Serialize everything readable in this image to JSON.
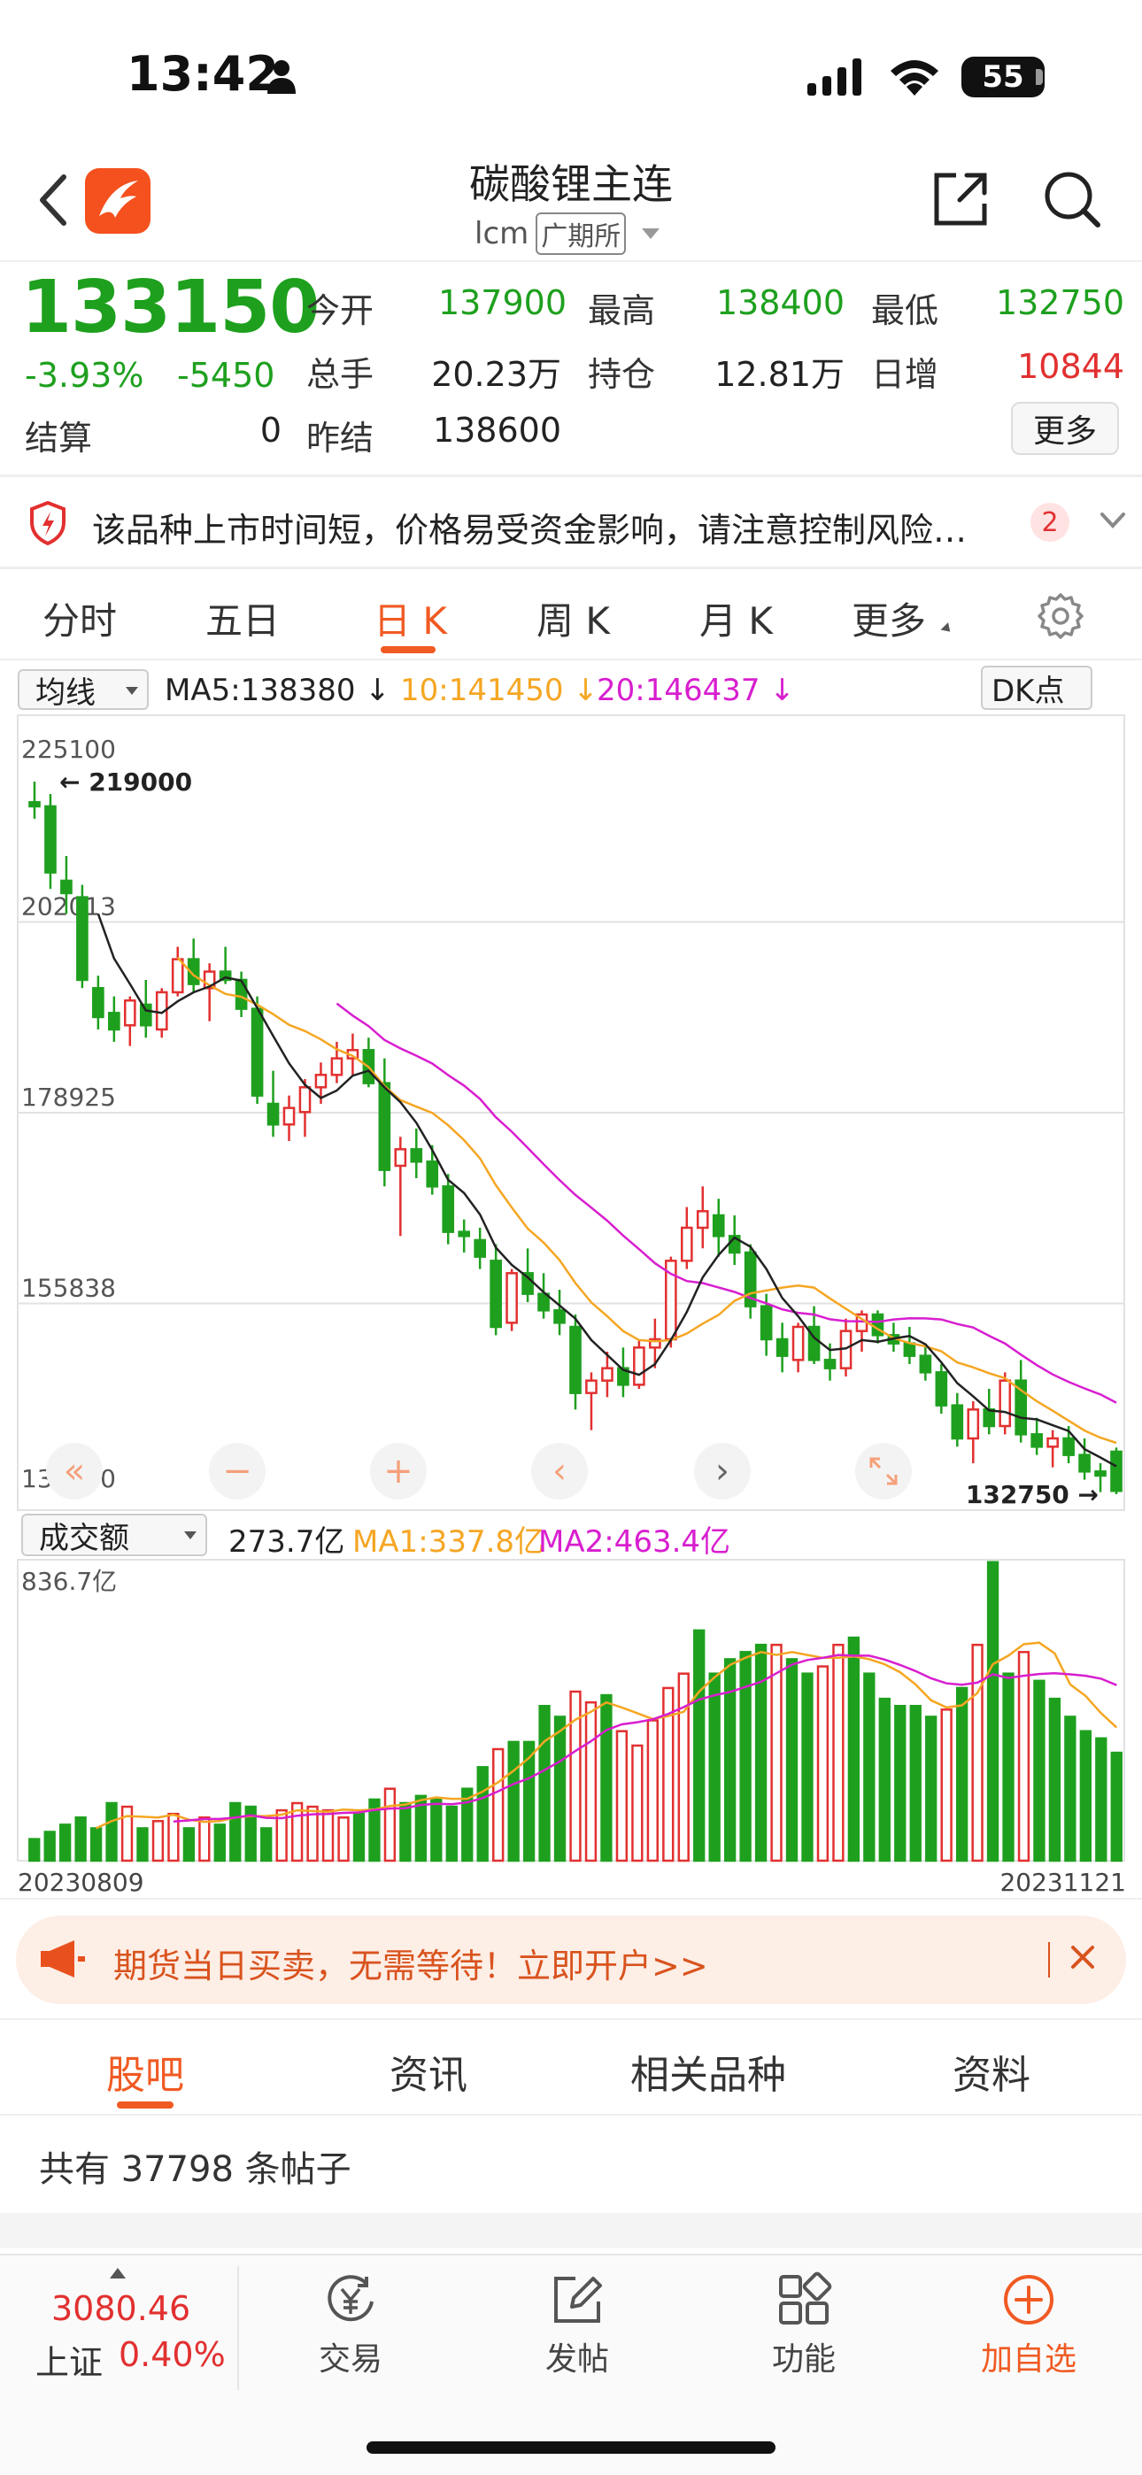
{
  "status_bar": {
    "time": "13:42",
    "battery": "55"
  },
  "header": {
    "title": "碳酸锂主连",
    "code": "lcm",
    "exchange": "广期所"
  },
  "quote": {
    "price": "133150",
    "change_pct": "-3.93%",
    "change": "-5450",
    "fields": [
      {
        "label": "今开",
        "value": "137900",
        "color": "green"
      },
      {
        "label": "最高",
        "value": "138400",
        "color": "green"
      },
      {
        "label": "最低",
        "value": "132750",
        "color": "green"
      },
      {
        "label": "总手",
        "value": "20.23万",
        "color": "black"
      },
      {
        "label": "持仓",
        "value": "12.81万",
        "color": "black"
      },
      {
        "label": "日增",
        "value": "10844",
        "color": "red"
      },
      {
        "label": "结算",
        "value": "0",
        "color": "black"
      },
      {
        "label": "昨结",
        "value": "138600",
        "color": "black"
      }
    ],
    "more_label": "更多"
  },
  "notice": {
    "text": "该品种上市时间短，价格易受资金影响，请注意控制风险…",
    "badge": "2"
  },
  "tabs": {
    "items": [
      "分时",
      "五日",
      "日 K",
      "周 K",
      "月 K",
      "更多"
    ],
    "active": 2
  },
  "indicators": {
    "ma_select": "均线",
    "ma5": "MA5:138380",
    "ma10": "10:141450",
    "ma20": "20:146437",
    "dk_label": "DK点",
    "vol_select": "成交额",
    "vol_value": "273.7亿",
    "vma1": "MA1:337.8亿",
    "vma2": "MA2:463.4亿"
  },
  "colors": {
    "up": "#e23030",
    "down": "#1ea01e",
    "ma5": "#222222",
    "ma10": "#f5a623",
    "ma20": "#d81ecf",
    "accent": "#f05a23"
  },
  "chart_data": [
    {
      "type": "candlestick",
      "y_ticks": [
        "225100",
        "202013",
        "178925",
        "155838",
        "132750"
      ],
      "ylim": [
        132750,
        225100
      ],
      "annotations": [
        "219000",
        "132750"
      ],
      "ohlc": [
        [
          216500,
          219000,
          214500,
          216000
        ],
        [
          216000,
          217500,
          206000,
          208000
        ],
        [
          207000,
          210000,
          203000,
          205500
        ],
        [
          205000,
          206500,
          194000,
          195000
        ],
        [
          194000,
          195500,
          189000,
          190500
        ],
        [
          191000,
          193000,
          187500,
          189000
        ],
        [
          189500,
          193000,
          187000,
          192500
        ],
        [
          192000,
          195000,
          188000,
          189500
        ],
        [
          189000,
          194000,
          188000,
          193500
        ],
        [
          193500,
          199000,
          193000,
          197500
        ],
        [
          197500,
          200000,
          193500,
          194500
        ],
        [
          194000,
          197000,
          190000,
          196000
        ],
        [
          196000,
          199000,
          194500,
          195000
        ],
        [
          195000,
          196000,
          190500,
          191500
        ],
        [
          191500,
          193000,
          180000,
          181000
        ],
        [
          180000,
          184000,
          176000,
          177500
        ],
        [
          177500,
          181000,
          175500,
          179500
        ],
        [
          179000,
          183000,
          176000,
          182000
        ],
        [
          182000,
          185000,
          180000,
          183500
        ],
        [
          183500,
          187500,
          182500,
          185500
        ],
        [
          185500,
          188500,
          183500,
          186500
        ],
        [
          186500,
          188000,
          182000,
          182500
        ],
        [
          182500,
          185500,
          170000,
          172000
        ],
        [
          172500,
          176000,
          164000,
          174500
        ],
        [
          174500,
          177000,
          171000,
          173000
        ],
        [
          173000,
          175000,
          169000,
          170000
        ],
        [
          170000,
          171500,
          163000,
          164500
        ],
        [
          164500,
          166000,
          162000,
          164000
        ],
        [
          163500,
          165000,
          160000,
          161500
        ],
        [
          161000,
          163000,
          152000,
          153000
        ],
        [
          153500,
          160000,
          152500,
          159500
        ],
        [
          159500,
          162500,
          156000,
          157000
        ],
        [
          157000,
          159500,
          154000,
          155000
        ],
        [
          155000,
          157500,
          152000,
          153500
        ],
        [
          153000,
          154500,
          143000,
          145000
        ],
        [
          145000,
          147500,
          140500,
          146500
        ],
        [
          146500,
          150000,
          144500,
          148000
        ],
        [
          148000,
          150500,
          144500,
          146000
        ],
        [
          146000,
          151500,
          145500,
          150500
        ],
        [
          150500,
          154000,
          148000,
          151500
        ],
        [
          151500,
          161500,
          150500,
          161000
        ],
        [
          161000,
          167500,
          160000,
          165000
        ],
        [
          165000,
          170000,
          162500,
          167000
        ],
        [
          166500,
          168500,
          161500,
          164000
        ],
        [
          164000,
          166500,
          160500,
          162000
        ],
        [
          162000,
          163000,
          154000,
          155500
        ],
        [
          155500,
          157000,
          149500,
          151500
        ],
        [
          151500,
          153500,
          147500,
          149500
        ],
        [
          149000,
          153500,
          147500,
          153000
        ],
        [
          153000,
          155500,
          148500,
          149000
        ],
        [
          149000,
          151000,
          146500,
          148000
        ],
        [
          148000,
          154000,
          147000,
          152500
        ],
        [
          152500,
          155000,
          150000,
          154500
        ],
        [
          154500,
          155000,
          151000,
          152000
        ],
        [
          152000,
          153500,
          150000,
          151000
        ],
        [
          151000,
          153000,
          148500,
          149500
        ],
        [
          149500,
          151000,
          146500,
          147500
        ],
        [
          147500,
          148500,
          142500,
          143500
        ],
        [
          143500,
          145000,
          138500,
          139500
        ],
        [
          139500,
          144000,
          136500,
          143000
        ],
        [
          143000,
          145500,
          140000,
          141000
        ],
        [
          141000,
          147500,
          140000,
          146500
        ],
        [
          146500,
          149000,
          139000,
          140000
        ],
        [
          140000,
          142000,
          137500,
          138500
        ],
        [
          138500,
          140500,
          136000,
          139500
        ],
        [
          139500,
          141000,
          136500,
          137500
        ],
        [
          137500,
          139500,
          134500,
          135500
        ],
        [
          135500,
          136500,
          133000,
          135000
        ],
        [
          137900,
          138400,
          132750,
          133150
        ]
      ],
      "ma5": "MA5:138380",
      "ma10": "10:141450",
      "ma20": "20:146437"
    },
    {
      "type": "bar",
      "title": "成交额",
      "y_top_label": "836.7亿",
      "x_start": "20230809",
      "x_end": "20231121",
      "ylim": [
        0,
        836.7
      ],
      "values": [
        60,
        80,
        100,
        120,
        90,
        160,
        150,
        90,
        110,
        130,
        90,
        120,
        100,
        160,
        150,
        90,
        140,
        160,
        150,
        140,
        120,
        130,
        170,
        200,
        160,
        180,
        170,
        150,
        200,
        260,
        310,
        330,
        330,
        430,
        400,
        470,
        440,
        460,
        360,
        320,
        390,
        480,
        520,
        640,
        520,
        560,
        580,
        600,
        600,
        560,
        520,
        540,
        600,
        620,
        520,
        450,
        430,
        430,
        400,
        420,
        480,
        600,
        830,
        520,
        580,
        500,
        450,
        400,
        360,
        340,
        300
      ],
      "ma1_label": "MA1:337.8亿",
      "ma2_label": "MA2:463.4亿"
    }
  ],
  "banner": {
    "text": "期货当日买卖，无需等待！立即开户>>"
  },
  "section_tabs": {
    "items": [
      "股吧",
      "资讯",
      "相关品种",
      "资料"
    ],
    "active": 0
  },
  "posts": {
    "text": "共有 37798 条帖子"
  },
  "bottom_nav": {
    "index_value": "3080.46",
    "index_name": "上证",
    "index_pct": "0.40%",
    "items": [
      "交易",
      "发帖",
      "功能",
      "加自选"
    ]
  }
}
